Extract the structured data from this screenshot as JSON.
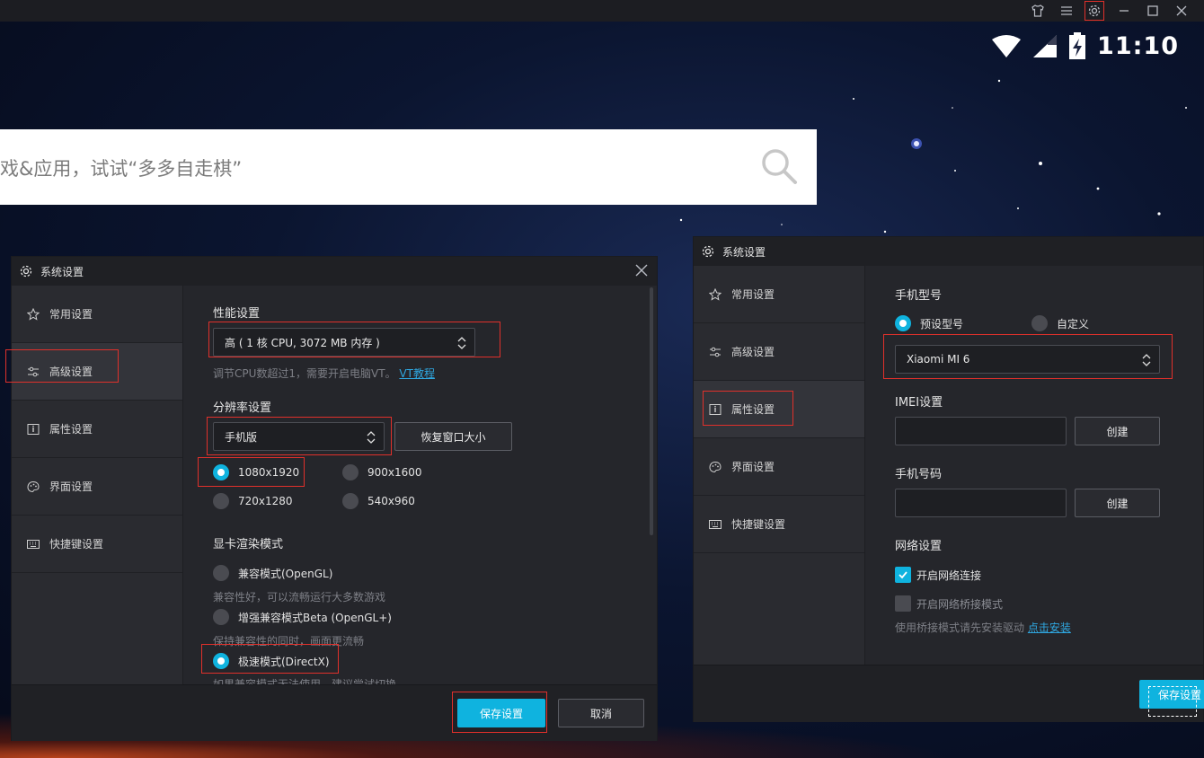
{
  "status": {
    "time": "11:10"
  },
  "search": {
    "placeholder": "戏&应用，试试“多多自走棋”"
  },
  "topbar": {
    "icons": [
      "shirt-icon",
      "menu-icon",
      "settings-icon",
      "minimize-icon",
      "maximize-icon",
      "close-icon"
    ]
  },
  "left_dialog": {
    "title": "系统设置",
    "sidebar": [
      "常用设置",
      "高级设置",
      "属性设置",
      "界面设置",
      "快捷键设置"
    ],
    "active_item": "高级设置",
    "perf": {
      "title": "性能设置",
      "select_value": "高 ( 1 核 CPU, 3072 MB 内存 )",
      "hint": "调节CPU数超过1，需要开启电脑VT。",
      "link": "VT教程"
    },
    "resolution": {
      "title": "分辨率设置",
      "select_value": "手机版",
      "restore_button": "恢复窗口大小",
      "options": [
        "1080x1920",
        "900x1600",
        "720x1280",
        "540x960"
      ],
      "selected": "1080x1920"
    },
    "render": {
      "title": "显卡渲染模式",
      "options": [
        {
          "label": "兼容模式(OpenGL)",
          "hint": "兼容性好，可以流畅运行大多数游戏"
        },
        {
          "label": "增强兼容模式Beta (OpenGL+)",
          "hint": "保持兼容性的同时，画面更流畅"
        },
        {
          "label": "极速模式(DirectX)",
          "hint": "如果兼容模式无法使用，建议尝试切换"
        }
      ],
      "selected": "极速模式(DirectX)"
    },
    "save_button": "保存设置",
    "cancel_button": "取消"
  },
  "right_dialog": {
    "title": "系统设置",
    "sidebar": [
      "常用设置",
      "高级设置",
      "属性设置",
      "界面设置",
      "快捷键设置"
    ],
    "active_item": "属性设置",
    "model": {
      "title": "手机型号",
      "options": [
        "预设型号",
        "自定义"
      ],
      "selected": "预设型号",
      "select_value": "Xiaomi  MI 6"
    },
    "imei": {
      "title": "IMEI设置",
      "create_button": "创建"
    },
    "phone": {
      "title": "手机号码",
      "create_button": "创建"
    },
    "network": {
      "title": "网络设置",
      "enable_label": "开启网络连接",
      "enable_checked": true,
      "bridge_label": "开启网络桥接模式",
      "bridge_checked": false,
      "hint": "使用桥接模式请先安装驱动",
      "link": "点击安装"
    },
    "save_button": "保存设置"
  },
  "colors": {
    "accent": "#0fb3df",
    "highlight": "#e0302b",
    "dialog_bg": "#25262b"
  }
}
